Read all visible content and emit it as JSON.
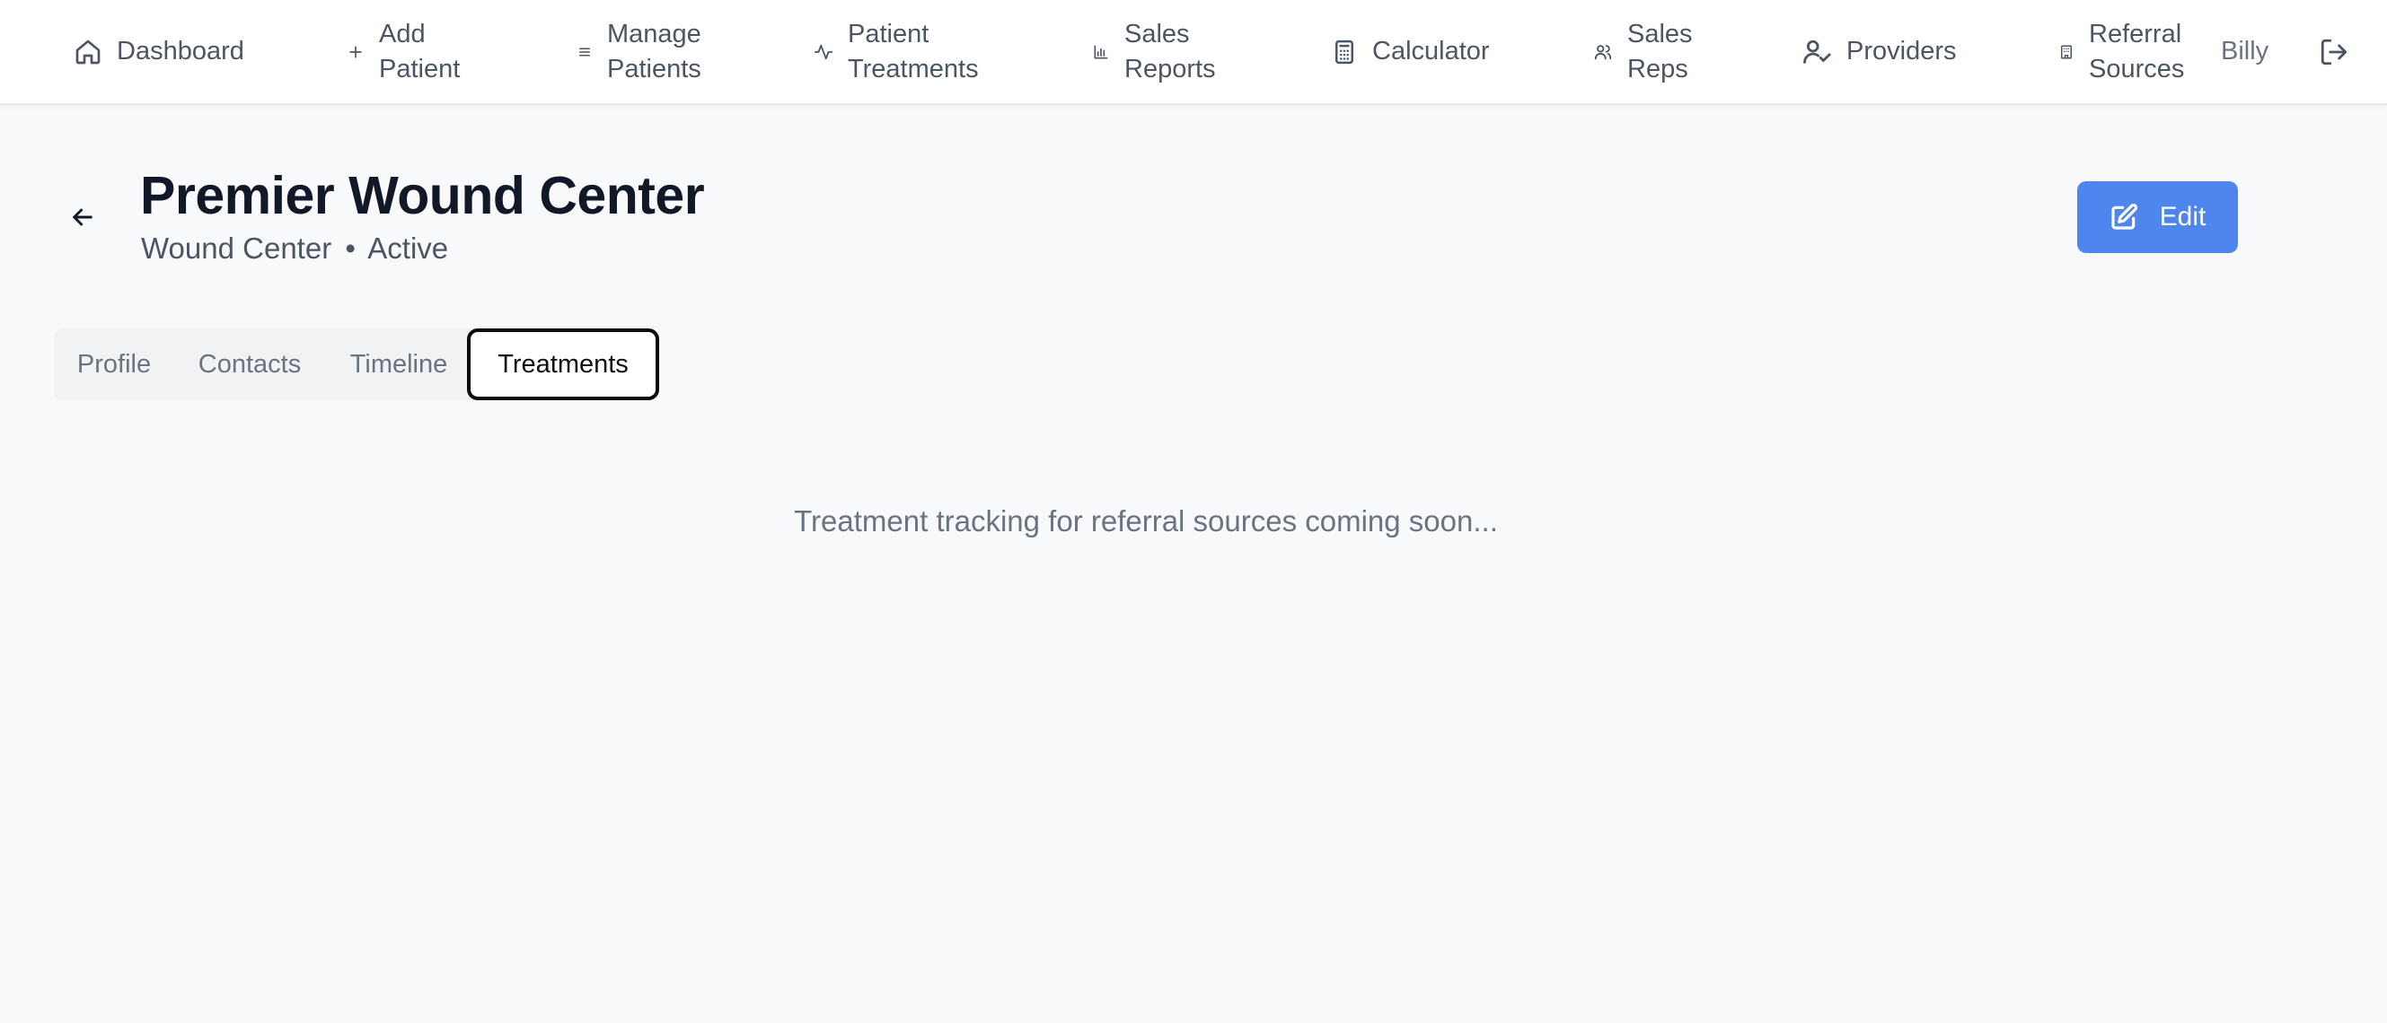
{
  "nav": {
    "items": [
      {
        "label": "Dashboard",
        "icon": "home-icon"
      },
      {
        "label": "Add Patient",
        "icon": "plus-icon"
      },
      {
        "label": "Manage Patients",
        "icon": "list-icon"
      },
      {
        "label": "Patient Treatments",
        "icon": "activity-icon"
      },
      {
        "label": "Sales Reports",
        "icon": "bar-chart-icon"
      },
      {
        "label": "Calculator",
        "icon": "calculator-icon"
      },
      {
        "label": "Sales Reps",
        "icon": "users-icon"
      },
      {
        "label": "Providers",
        "icon": "user-check-icon"
      },
      {
        "label": "Referral Sources",
        "icon": "building-icon"
      }
    ],
    "user_name": "Billy",
    "logout_icon": "logout-icon"
  },
  "header": {
    "title": "Premier Wound Center",
    "type": "Wound Center",
    "separator": "•",
    "status": "Active",
    "edit_label": "Edit"
  },
  "tabs": [
    {
      "label": "Profile"
    },
    {
      "label": "Contacts"
    },
    {
      "label": "Timeline"
    },
    {
      "label": "Treatments",
      "active": true
    }
  ],
  "content": {
    "message": "Treatment tracking for referral sources coming soon..."
  },
  "colors": {
    "accent": "#4f86ed",
    "background": "#f8f9fb",
    "text_dark": "#111827",
    "text_muted": "#6b7280"
  }
}
